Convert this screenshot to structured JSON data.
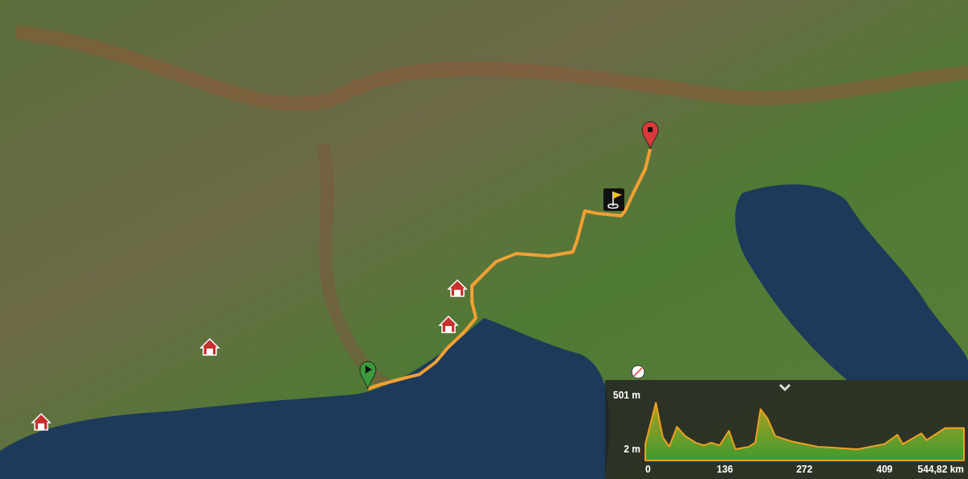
{
  "map": {
    "markers": [
      {
        "kind": "start"
      },
      {
        "kind": "end"
      },
      {
        "kind": "flag"
      },
      {
        "kind": "home"
      },
      {
        "kind": "home"
      },
      {
        "kind": "home"
      },
      {
        "kind": "home"
      },
      {
        "kind": "compass"
      }
    ]
  },
  "elevation_profile": {
    "chart_data": {
      "type": "area",
      "x": [
        0,
        18,
        30,
        41,
        54,
        68,
        86,
        100,
        113,
        127,
        143,
        154,
        177,
        188,
        197,
        209,
        222,
        250,
        295,
        363,
        409,
        431,
        440,
        472,
        481,
        513,
        544.82
      ],
      "series": [
        {
          "color": "#f0a020",
          "values": [
            50,
            432,
            111,
            25,
            210,
            124,
            62,
            37,
            62,
            37,
            173,
            2,
            25,
            62,
            373,
            286,
            124,
            74,
            25,
            2,
            50,
            136,
            50,
            148,
            87,
            198,
            198
          ]
        }
      ],
      "xlim": [
        0,
        544.82
      ],
      "ylim": [
        2,
        501
      ],
      "xticks": [
        0,
        136,
        272,
        409,
        {
          "value": 544.82,
          "label": "544,82 km"
        }
      ],
      "yticks": [
        {
          "value": 501,
          "label": "501 m"
        },
        {
          "value": 2,
          "label": "2 m"
        }
      ]
    }
  }
}
